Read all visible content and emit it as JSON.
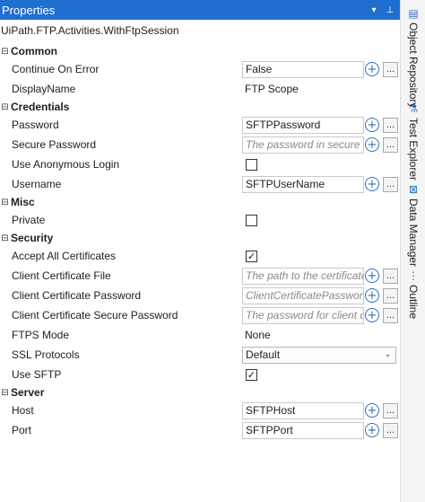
{
  "panel": {
    "title": "Properties",
    "dropdown_icon": "chevron-down-icon",
    "pin_icon": "pin-icon",
    "activity_name": "UiPath.FTP.Activities.WithFtpSession"
  },
  "categories": {
    "common": "Common",
    "credentials": "Credentials",
    "misc": "Misc",
    "security": "Security",
    "server": "Server"
  },
  "props": {
    "continue_on_error": {
      "label": "Continue On Error",
      "value": "False"
    },
    "display_name": {
      "label": "DisplayName",
      "value": "FTP Scope"
    },
    "password": {
      "label": "Password",
      "value": "SFTPPassword"
    },
    "secure_password": {
      "label": "Secure Password",
      "placeholder": "The password in secure string"
    },
    "use_anonymous_login": {
      "label": "Use Anonymous Login",
      "checked": false
    },
    "username": {
      "label": "Username",
      "value": "SFTPUserName"
    },
    "private": {
      "label": "Private",
      "checked": false
    },
    "accept_all_certificates": {
      "label": "Accept All Certificates",
      "checked": true
    },
    "client_certificate_file": {
      "label": "Client Certificate File",
      "placeholder": "The path to the certificate used"
    },
    "client_certificate_password": {
      "label": "Client Certificate Password",
      "placeholder": "ClientCertificatePassword"
    },
    "client_certificate_secure_password": {
      "label": "Client Certificate Secure Password",
      "placeholder": "The password for client certificate"
    },
    "ftps_mode": {
      "label": "FTPS Mode",
      "value": "None"
    },
    "ssl_protocols": {
      "label": "SSL Protocols",
      "value": "Default"
    },
    "use_sftp": {
      "label": "Use SFTP",
      "checked": true
    },
    "host": {
      "label": "Host",
      "value": "SFTPHost"
    },
    "port": {
      "label": "Port",
      "value": "SFTPPort"
    }
  },
  "glyphs": {
    "collapse": "⊟",
    "plus": "+",
    "dots": "...",
    "check": "✓",
    "chevron": "⌄"
  },
  "sidebar": {
    "tabs": [
      {
        "label": "Object Repository",
        "icon": "object-repository-icon"
      },
      {
        "label": "Test Explorer",
        "icon": "test-explorer-icon"
      },
      {
        "label": "Data Manager",
        "icon": "data-manager-icon"
      },
      {
        "label": "Outline",
        "icon": "outline-icon"
      }
    ]
  },
  "colors": {
    "titlebar": "#1e6fd0",
    "accent": "#2f6fbf"
  }
}
